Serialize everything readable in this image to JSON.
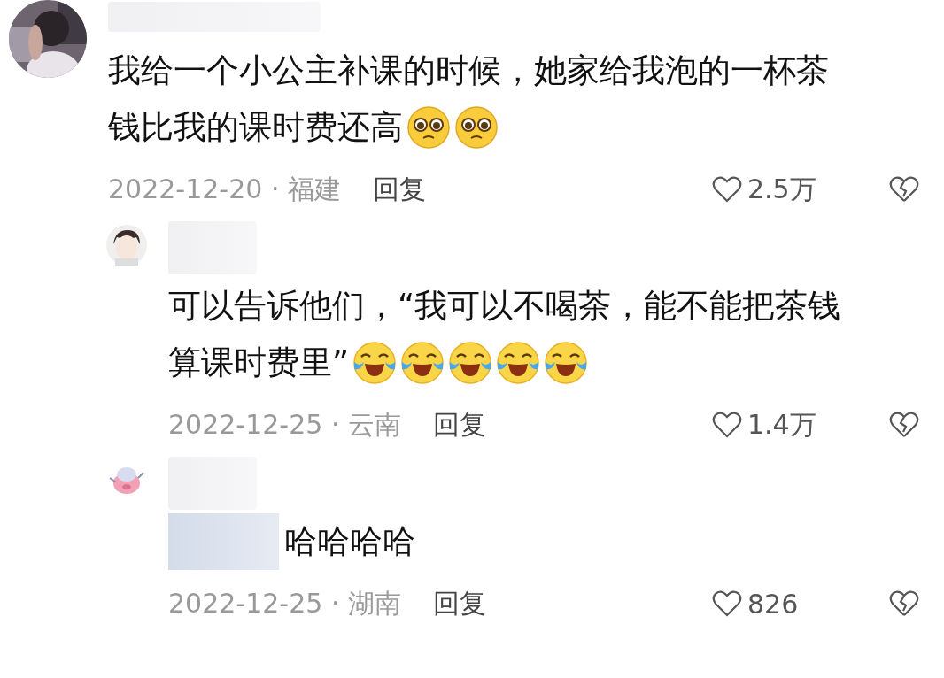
{
  "comments": [
    {
      "text_lines": [
        "我给一个小公主补课的时候，她家给我泡的一杯茶",
        "钱比我的课时费还高"
      ],
      "emojis": [
        {
          "kind": "pleading"
        },
        {
          "kind": "pleading"
        }
      ],
      "meta": "2022-12-20 · 福建",
      "reply_label": "回复",
      "likes": "2.5万",
      "replies": [
        {
          "avatar": {
            "kind": "cartoon"
          },
          "prefix_hidden": false,
          "text_lines": [
            "可以告诉他们，“我可以不喝茶，能不能把茶钱",
            "算课时费里”"
          ],
          "emojis": [
            {
              "kind": "laughing-tears"
            },
            {
              "kind": "laughing-tears"
            },
            {
              "kind": "laughing-tears"
            },
            {
              "kind": "laughing-tears"
            },
            {
              "kind": "laughing-tears"
            }
          ],
          "meta": "2022-12-25 · 云南",
          "reply_label": "回复",
          "likes": "1.4万"
        },
        {
          "avatar": {
            "kind": "pig"
          },
          "prefix_hidden": true,
          "text_lines": [
            "哈哈哈哈"
          ],
          "meta": "2022-12-25 · 湖南",
          "reply_label": "回复",
          "likes": "826"
        }
      ]
    }
  ]
}
